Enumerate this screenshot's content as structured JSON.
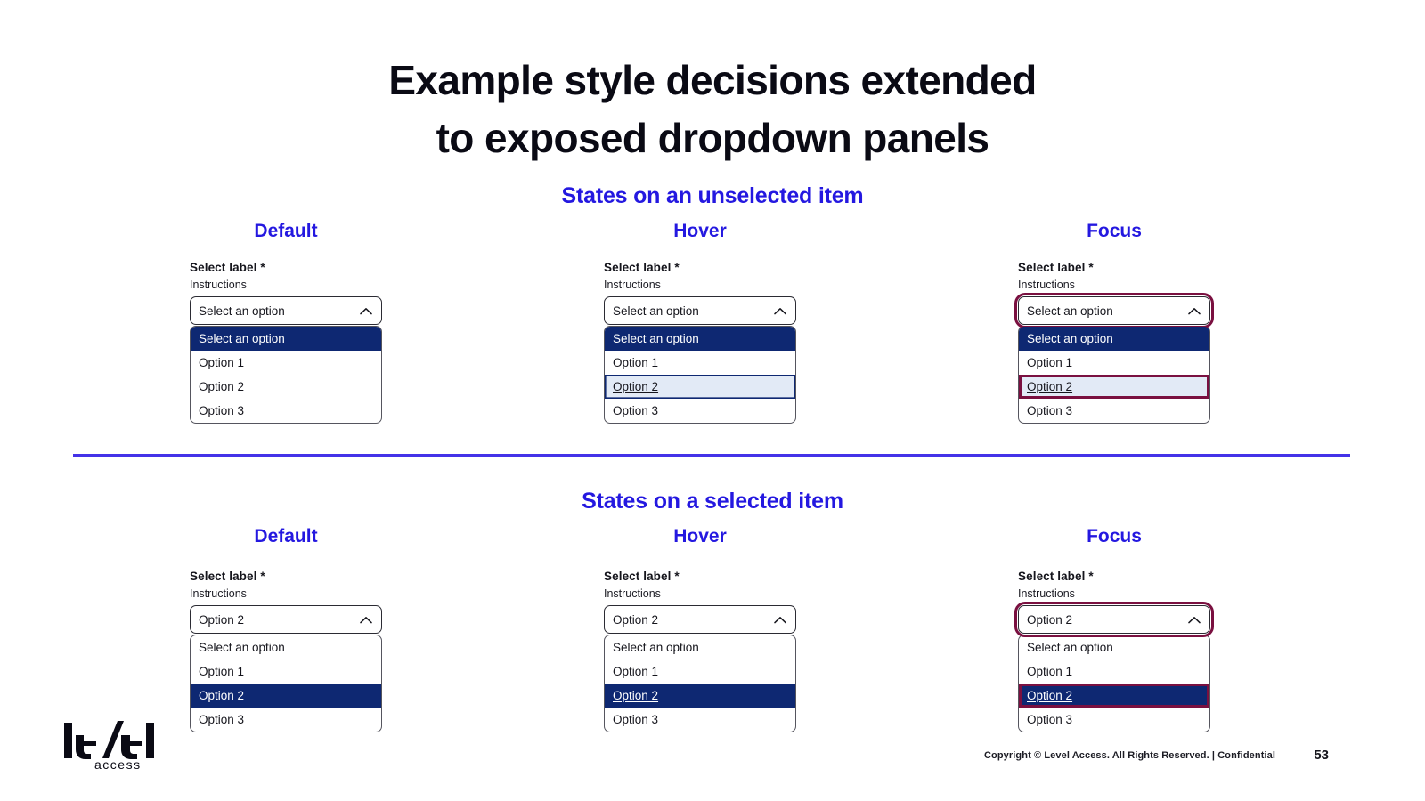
{
  "slide": {
    "title_lines": [
      "Example style decisions extended",
      "to exposed dropdown panels"
    ],
    "page_number": "53",
    "copyright": "Copyright © Level Access. All Rights Reserved. | Confidential",
    "logo": {
      "wordmark": "level",
      "subword": "access"
    },
    "colors": {
      "heading_blue": "#2418e0",
      "divider": "#4432e8",
      "option_navy": "#0e2872",
      "hover_bg": "#e2eaf6",
      "focus_ring": "#7a1040",
      "text": "#15151c"
    }
  },
  "sections": [
    {
      "heading": "States on an unselected item",
      "columns": [
        {
          "title": "Default",
          "field": {
            "label": "Select label *",
            "hint": "Instructions",
            "trigger_value": "Select an option",
            "chevron": "chevron-up-icon"
          },
          "options": [
            {
              "label": "Select an option",
              "selected": true,
              "hover": false,
              "focus": false
            },
            {
              "label": "Option 1",
              "selected": false,
              "hover": false,
              "focus": false
            },
            {
              "label": "Option 2",
              "selected": false,
              "hover": false,
              "focus": false
            },
            {
              "label": "Option 3",
              "selected": false,
              "hover": false,
              "focus": false
            }
          ],
          "trigger_focus": false
        },
        {
          "title": "Hover",
          "field": {
            "label": "Select label *",
            "hint": "Instructions",
            "trigger_value": "Select an option",
            "chevron": "chevron-up-icon"
          },
          "options": [
            {
              "label": "Select an option",
              "selected": true,
              "hover": false,
              "focus": false
            },
            {
              "label": "Option 1",
              "selected": false,
              "hover": false,
              "focus": false
            },
            {
              "label": "Option 2",
              "selected": false,
              "hover": true,
              "focus": false
            },
            {
              "label": "Option 3",
              "selected": false,
              "hover": false,
              "focus": false
            }
          ],
          "trigger_focus": false
        },
        {
          "title": "Focus",
          "field": {
            "label": "Select label *",
            "hint": "Instructions",
            "trigger_value": "Select an option",
            "chevron": "chevron-up-icon"
          },
          "options": [
            {
              "label": "Select an option",
              "selected": true,
              "hover": false,
              "focus": false
            },
            {
              "label": "Option 1",
              "selected": false,
              "hover": false,
              "focus": false
            },
            {
              "label": "Option 2",
              "selected": false,
              "hover": false,
              "focus": true
            },
            {
              "label": "Option 3",
              "selected": false,
              "hover": false,
              "focus": false
            }
          ],
          "trigger_focus": true
        }
      ]
    },
    {
      "heading": "States on a selected item",
      "columns": [
        {
          "title": "Default",
          "field": {
            "label": "Select label *",
            "hint": "Instructions",
            "trigger_value": "Option 2",
            "chevron": "chevron-up-icon"
          },
          "options": [
            {
              "label": "Select an option",
              "selected": false,
              "hover": false,
              "focus": false
            },
            {
              "label": "Option 1",
              "selected": false,
              "hover": false,
              "focus": false
            },
            {
              "label": "Option 2",
              "selected": true,
              "hover": false,
              "focus": false
            },
            {
              "label": "Option 3",
              "selected": false,
              "hover": false,
              "focus": false
            }
          ],
          "trigger_focus": false
        },
        {
          "title": "Hover",
          "field": {
            "label": "Select label *",
            "hint": "Instructions",
            "trigger_value": "Option 2",
            "chevron": "chevron-up-icon"
          },
          "options": [
            {
              "label": "Select an option",
              "selected": false,
              "hover": false,
              "focus": false
            },
            {
              "label": "Option 1",
              "selected": false,
              "hover": false,
              "focus": false
            },
            {
              "label": "Option 2",
              "selected": true,
              "hover": true,
              "focus": false
            },
            {
              "label": "Option 3",
              "selected": false,
              "hover": false,
              "focus": false
            }
          ],
          "trigger_focus": false
        },
        {
          "title": "Focus",
          "field": {
            "label": "Select label *",
            "hint": "Instructions",
            "trigger_value": "Option 2",
            "chevron": "chevron-up-icon"
          },
          "options": [
            {
              "label": "Select an option",
              "selected": false,
              "hover": false,
              "focus": false
            },
            {
              "label": "Option 1",
              "selected": false,
              "hover": false,
              "focus": false
            },
            {
              "label": "Option 2",
              "selected": true,
              "hover": false,
              "focus": true
            },
            {
              "label": "Option 3",
              "selected": false,
              "hover": false,
              "focus": false
            }
          ],
          "trigger_focus": true
        }
      ]
    }
  ]
}
